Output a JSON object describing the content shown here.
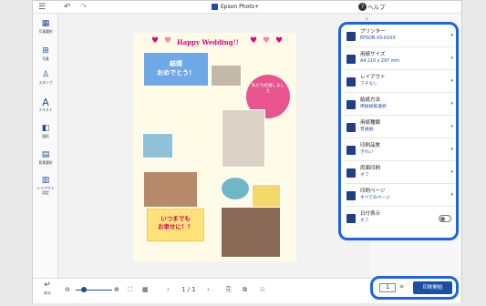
{
  "window": {
    "title": "Epson Photo+",
    "help_label": "ヘルプ"
  },
  "sidebar": {
    "items": [
      {
        "label": "写真選択",
        "icon": "photo-select-icon"
      },
      {
        "label": "写真",
        "icon": "add-photo-icon"
      },
      {
        "label": "スタンプ",
        "icon": "stamp-icon"
      },
      {
        "label": "テキスト",
        "icon": "text-icon"
      },
      {
        "label": "図形",
        "icon": "shape-icon"
      },
      {
        "label": "背景選択",
        "icon": "background-icon"
      },
      {
        "label": "レイアウト設定",
        "icon": "layout-icon"
      }
    ],
    "back_label": "戻る"
  },
  "canvas": {
    "title_text": "Happy Wedding!!",
    "blue_banner_line1": "結婚",
    "blue_banner_line2": "おめでとう！",
    "round_text": "私たち結婚しました",
    "yellow_banner_line1": "いつまでも",
    "yellow_banner_line2": "お幸せに！！"
  },
  "bottombar": {
    "page_indicator": "1 / 1"
  },
  "settings": [
    {
      "label": "プリンター",
      "value": "EPSON XX-XXXX",
      "icon": "printer-icon"
    },
    {
      "label": "用紙サイズ",
      "value": "A4 210 x 297 mm",
      "icon": "paper-size-icon"
    },
    {
      "label": "レイアウト",
      "value": "フチなし",
      "icon": "layout-borderless-icon"
    },
    {
      "label": "給紙方法",
      "value": "用紙総紙選択",
      "icon": "paper-feed-icon"
    },
    {
      "label": "用紙種類",
      "value": "普通紙",
      "icon": "paper-type-icon"
    },
    {
      "label": "印刷品質",
      "value": "きれい",
      "icon": "print-quality-icon"
    },
    {
      "label": "両面印刷",
      "value": "オフ",
      "icon": "duplex-icon"
    },
    {
      "label": "印刷ページ",
      "value": "すべてのページ",
      "icon": "print-pages-icon"
    },
    {
      "label": "日付表示",
      "value": "オフ",
      "icon": "date-icon"
    }
  ],
  "print": {
    "copies": "1",
    "button_label": "印刷開始"
  },
  "colors": {
    "accent": "#1c63e6",
    "brand": "#1c4ea3"
  }
}
